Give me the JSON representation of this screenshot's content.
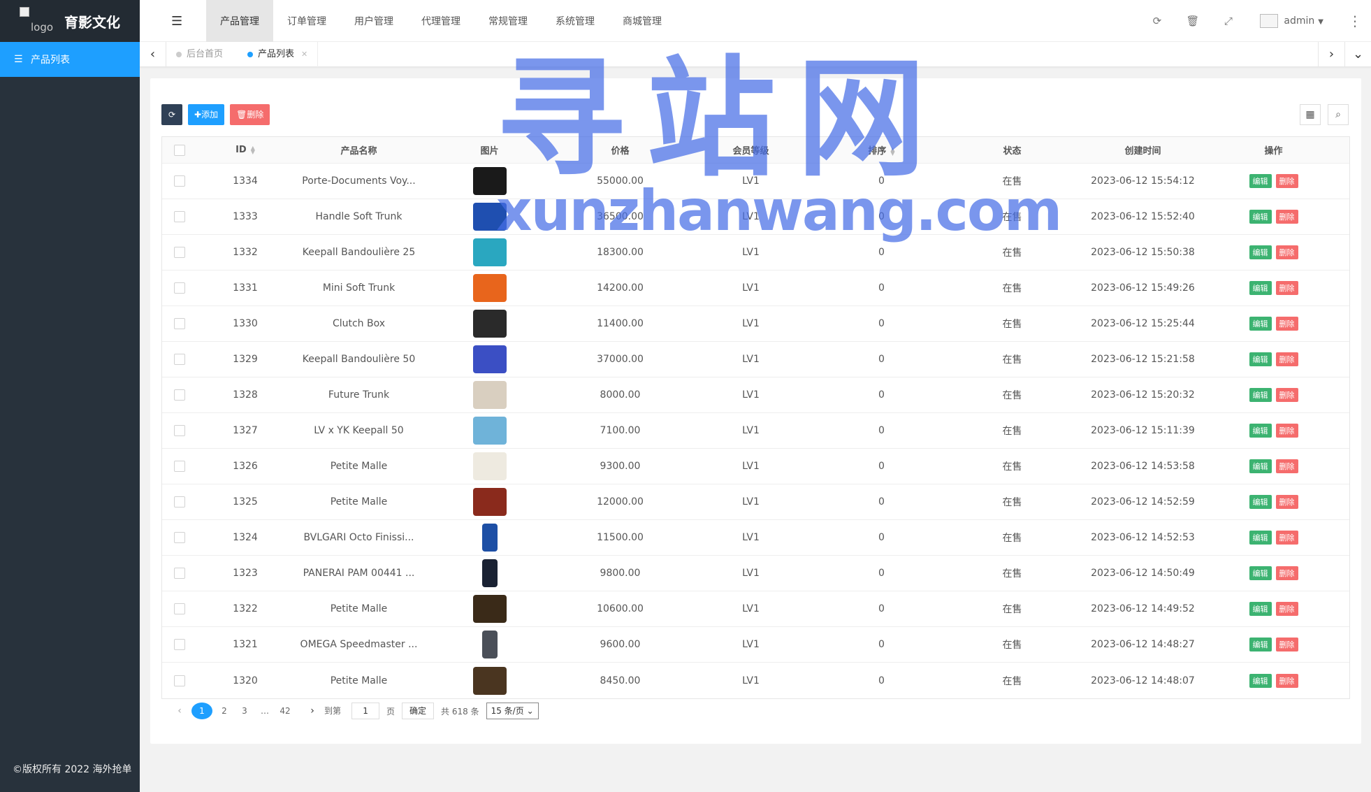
{
  "brand": {
    "logo_alt": "logo",
    "title": "育影文化"
  },
  "sidebar": {
    "items": [
      {
        "label": "产品列表",
        "icon": "list-icon"
      }
    ],
    "copyright": "©版权所有 2022 海外抢单"
  },
  "topnav": {
    "items": [
      {
        "label": "产品管理",
        "active": true
      },
      {
        "label": "订单管理"
      },
      {
        "label": "用户管理"
      },
      {
        "label": "代理管理"
      },
      {
        "label": "常规管理"
      },
      {
        "label": "系统管理"
      },
      {
        "label": "商城管理"
      }
    ],
    "right": {
      "refresh_icon": "refresh-icon",
      "clear_icon": "trash-icon",
      "fullscreen_icon": "fullscreen-icon",
      "user": "admin"
    }
  },
  "tabs": [
    {
      "label": "后台首页"
    },
    {
      "label": "产品列表",
      "active": true
    }
  ],
  "toolbar": {
    "add_label": "添加",
    "delete_label": "删除"
  },
  "table": {
    "columns": [
      "ID",
      "产品名称",
      "图片",
      "价格",
      "会员等级",
      "排序",
      "状态",
      "创建时间",
      "操作"
    ],
    "edit_label": "编辑",
    "delete_label": "删除",
    "rows": [
      {
        "id": "1334",
        "name": "Porte-Documents Voy...",
        "price": "55000.00",
        "level": "LV1",
        "sort": "0",
        "status": "在售",
        "time": "2023-06-12 15:54:12",
        "img_color": "#1a1a1a",
        "img_desc": "black-bag"
      },
      {
        "id": "1333",
        "name": "Handle Soft Trunk",
        "price": "36500.00",
        "level": "LV1",
        "sort": "0",
        "status": "在售",
        "time": "2023-06-12 15:52:40",
        "img_color": "#1f4fb0",
        "img_desc": "blue-trunk"
      },
      {
        "id": "1332",
        "name": "Keepall Bandoulière 25",
        "price": "18300.00",
        "level": "LV1",
        "sort": "0",
        "status": "在售",
        "time": "2023-06-12 15:50:38",
        "img_color": "#2aa7c0",
        "img_desc": "teal-bag"
      },
      {
        "id": "1331",
        "name": "Mini Soft Trunk",
        "price": "14200.00",
        "level": "LV1",
        "sort": "0",
        "status": "在售",
        "time": "2023-06-12 15:49:26",
        "img_color": "#e8651c",
        "img_desc": "orange-trunk"
      },
      {
        "id": "1330",
        "name": "Clutch Box",
        "price": "11400.00",
        "level": "LV1",
        "sort": "0",
        "status": "在售",
        "time": "2023-06-12 15:25:44",
        "img_color": "#2a2a2a",
        "img_desc": "black-clutch"
      },
      {
        "id": "1329",
        "name": "Keepall Bandoulière 50",
        "price": "37000.00",
        "level": "LV1",
        "sort": "0",
        "status": "在售",
        "time": "2023-06-12 15:21:58",
        "img_color": "#3b4fc4",
        "img_desc": "blue-floral-bag"
      },
      {
        "id": "1328",
        "name": "Future Trunk",
        "price": "8000.00",
        "level": "LV1",
        "sort": "0",
        "status": "在售",
        "time": "2023-06-12 15:20:32",
        "img_color": "#d9cfc0",
        "img_desc": "beige-trunk"
      },
      {
        "id": "1327",
        "name": "LV x YK Keepall 50",
        "price": "7100.00",
        "level": "LV1",
        "sort": "0",
        "status": "在售",
        "time": "2023-06-12 15:11:39",
        "img_color": "#6fb3d9",
        "img_desc": "light-blue-bag"
      },
      {
        "id": "1326",
        "name": "Petite Malle",
        "price": "9300.00",
        "level": "LV1",
        "sort": "0",
        "status": "在售",
        "time": "2023-06-12 14:53:58",
        "img_color": "#eeeae0",
        "img_desc": "white-malle"
      },
      {
        "id": "1325",
        "name": "Petite Malle",
        "price": "12000.00",
        "level": "LV1",
        "sort": "0",
        "status": "在售",
        "time": "2023-06-12 14:52:59",
        "img_color": "#8a2a1c",
        "img_desc": "red-malle"
      },
      {
        "id": "1324",
        "name": "BVLGARI Octo Finissi...",
        "price": "11500.00",
        "level": "LV1",
        "sort": "0",
        "status": "在售",
        "time": "2023-06-12 14:52:53",
        "img_color": "#1d4fa5",
        "img_desc": "blue-watch"
      },
      {
        "id": "1323",
        "name": "PANERAI PAM 00441 ...",
        "price": "9800.00",
        "level": "LV1",
        "sort": "0",
        "status": "在售",
        "time": "2023-06-12 14:50:49",
        "img_color": "#1a2233",
        "img_desc": "black-watch"
      },
      {
        "id": "1322",
        "name": "Petite Malle",
        "price": "10600.00",
        "level": "LV1",
        "sort": "0",
        "status": "在售",
        "time": "2023-06-12 14:49:52",
        "img_color": "#3a2a18",
        "img_desc": "brown-malle"
      },
      {
        "id": "1321",
        "name": "OMEGA Speedmaster ...",
        "price": "9600.00",
        "level": "LV1",
        "sort": "0",
        "status": "在售",
        "time": "2023-06-12 14:48:27",
        "img_color": "#4a4f58",
        "img_desc": "steel-watch"
      },
      {
        "id": "1320",
        "name": "Petite Malle",
        "price": "8450.00",
        "level": "LV1",
        "sort": "0",
        "status": "在售",
        "time": "2023-06-12 14:48:07",
        "img_color": "#4a3520",
        "img_desc": "monogram-malle"
      }
    ]
  },
  "pager": {
    "pages": [
      "1",
      "2",
      "3",
      "…",
      "42"
    ],
    "goto_label": "到第",
    "goto_value": "1",
    "page_unit": "页",
    "confirm": "确定",
    "total": "共 618 条",
    "per_page": "15 条/页"
  },
  "watermark": {
    "big": "寻站网",
    "url": "xunzhanwang.com"
  }
}
